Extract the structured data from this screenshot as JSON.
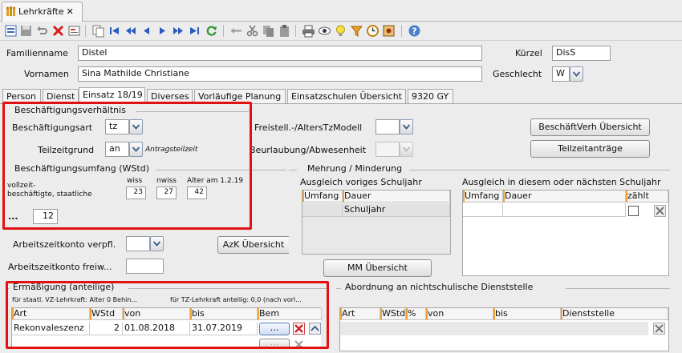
{
  "document_tab": {
    "title": "Lehrkräfte",
    "close": "✕"
  },
  "person": {
    "familienname_label": "Familienname",
    "familienname_value": "Distel",
    "vornamen_label": "Vornamen",
    "vornamen_value": "Sina Mathilde Christiane",
    "kuerzel_label": "Kürzel",
    "kuerzel_value": "DisS",
    "geschlecht_label": "Geschlecht",
    "geschlecht_value": "W"
  },
  "tabs": [
    {
      "label": "Person"
    },
    {
      "label": "Dienst"
    },
    {
      "label": "Einsatz 18/19"
    },
    {
      "label": "Diverses"
    },
    {
      "label": "Vorläufige Planung"
    },
    {
      "label": "Einsatzschulen Übersicht"
    },
    {
      "label": "9320 GY"
    }
  ],
  "beschaeftigung": {
    "group_title": "Beschäftigungsverhältnis",
    "art_label": "Beschäftigungsart",
    "art_value": "tz",
    "teilzeitgrund_label": "Teilzeitgrund",
    "teilzeitgrund_value": "an",
    "teilzeitgrund_note": "Antragsteilzeit",
    "freistell_label": "Freistell.-/AltersTzModell",
    "beurlaubung_label": "Beurlaubung/Abwesenheit",
    "verh_btn": "BeschäftVerh Übersicht",
    "teilzeit_btn": "Teilzeitanträge"
  },
  "umfang": {
    "group_title": "Beschäftigungsumfang (WStd)",
    "vollzeit_label_1": "vollzeit-",
    "vollzeit_label_2": "beschäftigte, staatliche",
    "wiss_label": "wiss",
    "wiss_value": "23",
    "nwiss_label": "nwiss",
    "nwiss_value": "27",
    "alter_label": "Alter am 1.2.19",
    "alter_value": "42",
    "ellipsis_label": "...",
    "total_value": "12"
  },
  "arbeitszeit": {
    "verpfl_label": "Arbeitszeitkonto verpfl.",
    "freiw_label": "Arbeitszeitkonto freiw...",
    "azk_btn": "AzK Übersicht"
  },
  "mehrung": {
    "group_title": "Mehrung / Minderung",
    "left_title": "Ausgleich voriges Schuljahr",
    "left_cols": [
      "Umfang",
      "Dauer"
    ],
    "left_row_value": "Schuljahr",
    "right_title": "Ausgleich in diesem oder nächsten Schuljahr",
    "right_cols": [
      "Umfang",
      "Dauer",
      "zählt"
    ],
    "mm_btn": "MM Übersicht"
  },
  "ermaessigung": {
    "group_title": "Ermäßigung (anteilige)",
    "note_1": "für staatl. VZ-Lehrkraft: Alter 0 Behin...",
    "note_2": "für TZ-Lehrkraft anteilig: 0,0 (nach vorl...",
    "cols": [
      "Art",
      "WStd",
      "von",
      "bis",
      "Bem"
    ],
    "row": {
      "art": "Rekonvaleszenz",
      "wstd": "2",
      "von": "01.08.2018",
      "bis": "31.07.2019",
      "bem_btn": "..."
    }
  },
  "abordnung": {
    "group_title": "Abordnung an nichtschulische Dienststelle",
    "cols": [
      "Art",
      "WStd",
      "%",
      "von",
      "bis",
      "Dienststelle"
    ]
  },
  "colors": {
    "highlight": "#e21010",
    "accent_mark": "#f0a030",
    "delete": "#d42020"
  }
}
